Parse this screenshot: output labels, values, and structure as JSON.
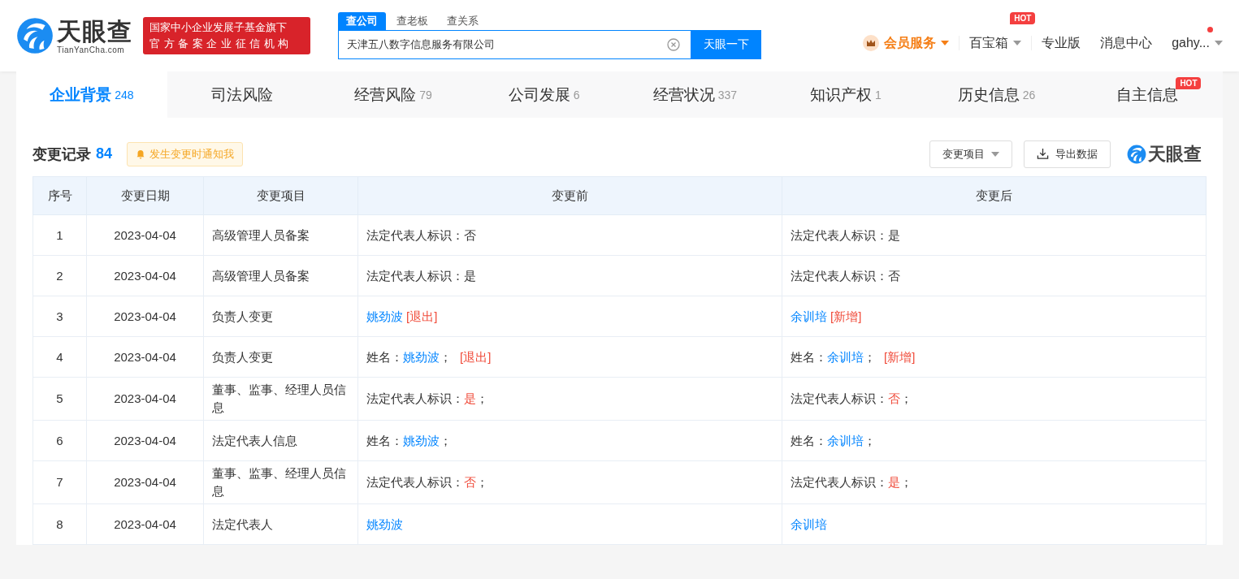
{
  "header": {
    "logo": {
      "name": "天眼查",
      "domain": "TianYanCha.com"
    },
    "badge_lines": [
      "国家中小企业发展子基金旗下",
      "官方备案企业征信机构"
    ],
    "search": {
      "tabs": [
        {
          "label": "查公司",
          "selected": true
        },
        {
          "label": "查老板",
          "selected": false
        },
        {
          "label": "查关系",
          "selected": false
        }
      ],
      "value": "天津五八数字信息服务有限公司",
      "button": "天眼一下"
    },
    "nav": [
      {
        "kind": "member",
        "label": "会员服务",
        "dropdown": true,
        "dot": false
      },
      {
        "kind": "menu",
        "label": "百宝箱",
        "dropdown": true,
        "hot": "HOT",
        "dot": false
      },
      {
        "kind": "link",
        "label": "专业版",
        "dropdown": false,
        "dot": false
      },
      {
        "kind": "link",
        "label": "消息中心",
        "dropdown": false,
        "dot": false
      },
      {
        "kind": "user",
        "label": "gahy...",
        "dropdown": true,
        "dot": true
      }
    ]
  },
  "tabs": [
    {
      "label": "企业背景",
      "count": "248",
      "selected": true
    },
    {
      "label": "司法风险",
      "selected": false
    },
    {
      "label": "经营风险",
      "count": "79",
      "selected": false
    },
    {
      "label": "公司发展",
      "count": "6",
      "selected": false
    },
    {
      "label": "经营状况",
      "count": "337",
      "selected": false
    },
    {
      "label": "知识产权",
      "count": "1",
      "selected": false
    },
    {
      "label": "历史信息",
      "count": "26",
      "selected": false
    },
    {
      "label": "自主信息",
      "selected": false,
      "hot": "HOT"
    }
  ],
  "section": {
    "title": "变更记录",
    "count": "84",
    "notify_button": "发生变更时通知我",
    "filter_dropdown": "变更项目",
    "export_button": "导出数据",
    "brand": "天眼查"
  },
  "table": {
    "columns": [
      "序号",
      "变更日期",
      "变更项目",
      "变更前",
      "变更后"
    ],
    "rows": [
      {
        "index": "1",
        "date": "2023-04-04",
        "item": "高级管理人员备案",
        "before": [
          {
            "kind": "text",
            "text": "法定代表人标识：否"
          }
        ],
        "after": [
          {
            "kind": "text",
            "text": "法定代表人标识：是"
          }
        ]
      },
      {
        "index": "2",
        "date": "2023-04-04",
        "item": "高级管理人员备案",
        "before": [
          {
            "kind": "text",
            "text": "法定代表人标识：是"
          }
        ],
        "after": [
          {
            "kind": "text",
            "text": "法定代表人标识：否"
          }
        ]
      },
      {
        "index": "3",
        "date": "2023-04-04",
        "item": "负责人变更",
        "before": [
          {
            "kind": "person",
            "text": "姚劲波"
          },
          {
            "kind": "tag",
            "text": "[退出]"
          }
        ],
        "after": [
          {
            "kind": "person",
            "text": "余训培"
          },
          {
            "kind": "tag",
            "text": "[新增]"
          }
        ]
      },
      {
        "index": "4",
        "date": "2023-04-04",
        "item": "负责人变更",
        "before": [
          {
            "kind": "text",
            "text": "姓名："
          },
          {
            "kind": "person",
            "text": "姚劲波"
          },
          {
            "kind": "text",
            "text": "；"
          },
          {
            "kind": "tag",
            "text": "[退出]"
          }
        ],
        "after": [
          {
            "kind": "text",
            "text": "姓名："
          },
          {
            "kind": "person",
            "text": "余训培"
          },
          {
            "kind": "text",
            "text": "；"
          },
          {
            "kind": "tag",
            "text": "[新增]"
          }
        ]
      },
      {
        "index": "5",
        "date": "2023-04-04",
        "item": "董事、监事、经理人员信息",
        "before": [
          {
            "kind": "text",
            "text": "法定代表人标识："
          },
          {
            "kind": "flag",
            "text": "是"
          },
          {
            "kind": "text",
            "text": "；"
          }
        ],
        "after": [
          {
            "kind": "text",
            "text": "法定代表人标识："
          },
          {
            "kind": "flag",
            "text": "否"
          },
          {
            "kind": "text",
            "text": "；"
          }
        ]
      },
      {
        "index": "6",
        "date": "2023-04-04",
        "item": "法定代表人信息",
        "before": [
          {
            "kind": "text",
            "text": "姓名："
          },
          {
            "kind": "person",
            "text": "姚劲波"
          },
          {
            "kind": "text",
            "text": "；"
          }
        ],
        "after": [
          {
            "kind": "text",
            "text": "姓名："
          },
          {
            "kind": "person",
            "text": "余训培"
          },
          {
            "kind": "text",
            "text": "；"
          }
        ]
      },
      {
        "index": "7",
        "date": "2023-04-04",
        "item": "董事、监事、经理人员信息",
        "before": [
          {
            "kind": "text",
            "text": "法定代表人标识："
          },
          {
            "kind": "flag",
            "text": "否"
          },
          {
            "kind": "text",
            "text": "；"
          }
        ],
        "after": [
          {
            "kind": "text",
            "text": "法定代表人标识："
          },
          {
            "kind": "flag",
            "text": "是"
          },
          {
            "kind": "text",
            "text": "；"
          }
        ]
      },
      {
        "index": "8",
        "date": "2023-04-04",
        "item": "法定代表人",
        "before": [
          {
            "kind": "person",
            "text": "姚劲波"
          }
        ],
        "after": [
          {
            "kind": "person",
            "text": "余训培"
          }
        ]
      }
    ]
  }
}
